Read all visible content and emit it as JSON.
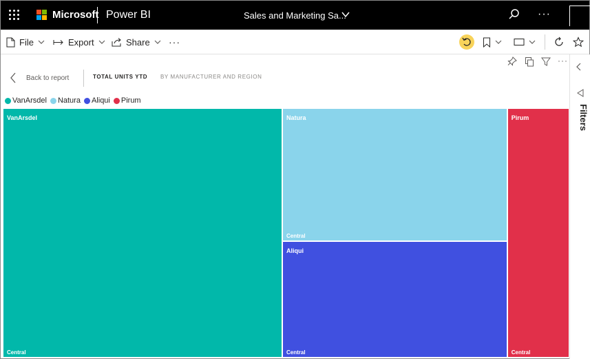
{
  "header": {
    "brand": "Microsoft",
    "product": "Power BI",
    "report_title": "Sales and Marketing Sa...",
    "more": "···"
  },
  "actionbar": {
    "file_label": "File",
    "export_label": "Export",
    "share_label": "Share",
    "more": "···"
  },
  "visual_header": {
    "back_label": "Back to report",
    "title": "TOTAL UNITS YTD",
    "subtitle": "BY MANUFACTURER AND REGION"
  },
  "filters": {
    "label": "Filters"
  },
  "colors": {
    "VanArsdel": "#01b8aa",
    "Natura": "#8ad4eb",
    "Aliqui": "#4050e0",
    "Pirum": "#e1304a",
    "accent_yellow": "#f8d35a"
  },
  "chart_data": {
    "type": "treemap",
    "title": "TOTAL UNITS YTD",
    "subtitle": "BY MANUFACTURER AND REGION",
    "legend": [
      "VanArsdel",
      "Natura",
      "Aliqui",
      "Pirum"
    ],
    "groups": [
      {
        "name": "VanArsdel",
        "children": [
          {
            "name": "Central",
            "value": 404
          }
        ]
      },
      {
        "name": "Natura",
        "children": [
          {
            "name": "Central",
            "value": 174
          }
        ]
      },
      {
        "name": "Aliqui",
        "children": [
          {
            "name": "Central",
            "value": 152
          }
        ]
      },
      {
        "name": "Pirum",
        "children": [
          {
            "name": "Central",
            "value": 89
          }
        ]
      }
    ]
  }
}
